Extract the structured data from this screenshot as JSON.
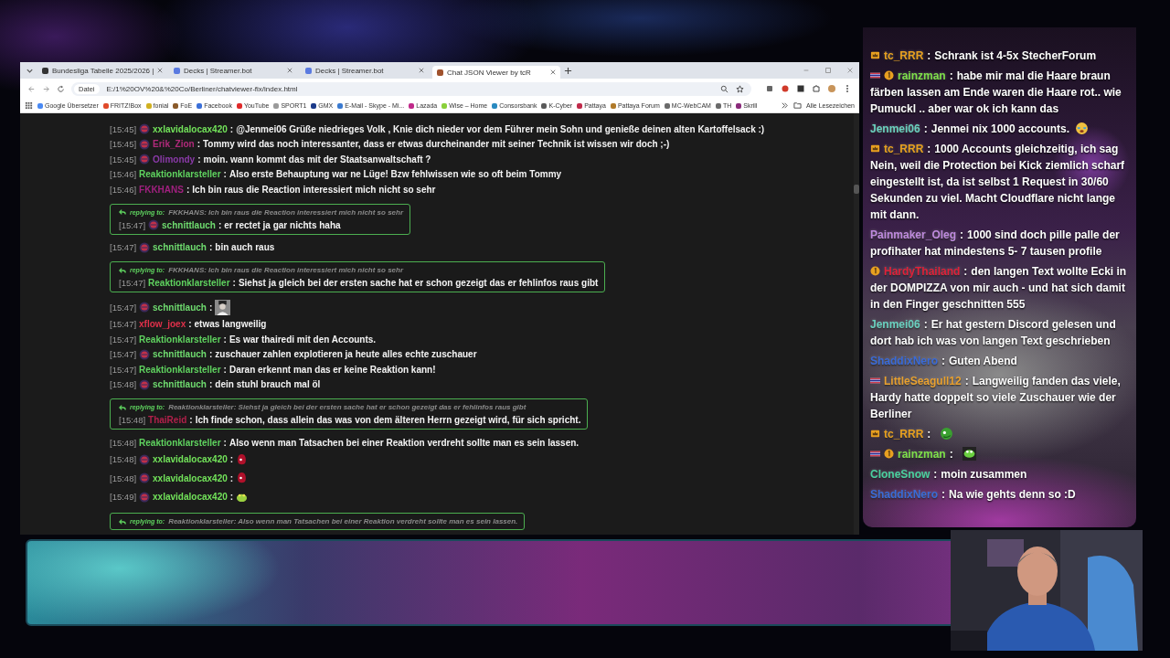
{
  "browser": {
    "tabs": [
      {
        "label": "Bundesliga Tabelle 2025/2026 |",
        "selected": false
      },
      {
        "label": "Decks | Streamer.bot",
        "selected": false
      },
      {
        "label": "Decks | Streamer.bot",
        "selected": false
      },
      {
        "label": "Chat JSON Viewer by tcR",
        "selected": true
      }
    ],
    "address": {
      "scheme": "Datei",
      "url": "E:/1%20OV%20&%20Co/Berliner/chatviewer-fix/index.html"
    },
    "bookmarks": [
      {
        "label": "Google Übersetzer",
        "color": "#4a8af4"
      },
      {
        "label": "FRITZ!Box",
        "color": "#e04a2a"
      },
      {
        "label": "fonial",
        "color": "#d0b020"
      },
      {
        "label": "FoE",
        "color": "#8a5a2a"
      },
      {
        "label": "Facebook",
        "color": "#3b6fd8"
      },
      {
        "label": "YouTube",
        "color": "#e02a2a"
      },
      {
        "label": "SPORT1",
        "color": "#9a9a9a"
      },
      {
        "label": "GMX",
        "color": "#1c3a8a"
      },
      {
        "label": "E-Mail - Skype - Mi...",
        "color": "#3a7ad0"
      },
      {
        "label": "Lazada",
        "color": "#c02a8a"
      },
      {
        "label": "Wise – Home",
        "color": "#8ad03a"
      },
      {
        "label": "Consorsbank",
        "color": "#2a8ac0"
      },
      {
        "label": "K-Cyber",
        "color": "#5a5a5a"
      },
      {
        "label": "Pattaya",
        "color": "#c02a4a"
      },
      {
        "label": "Pattaya Forum",
        "color": "#b07a2a"
      },
      {
        "label": "MC-WebCAM",
        "color": "#6a6a6a"
      },
      {
        "label": "TH",
        "color": "#6a6a6a"
      },
      {
        "label": "Skrill",
        "color": "#8a2a7a"
      }
    ],
    "all_bookmarks": "Alle Lesezeichen"
  },
  "chat": {
    "messages": [
      {
        "kind": "message",
        "time": "[15:45]",
        "user": "xxlavidalocax420",
        "color": "#72e35a",
        "badge": true,
        "sep": ":",
        "text": "@Jenmei06 Grüße niedrieges Volk , Knie dich nieder vor dem Führer mein Sohn und genieße deinen alten Kartoffelsack :)"
      },
      {
        "kind": "message",
        "time": "[15:45]",
        "user": "Erik_Zion",
        "color": "#b02a7a",
        "badge": true,
        "sep": ":",
        "text": "Tommy wird das noch interessanter, dass er etwas durcheinander mit seiner Technik ist wissen wir doch ;-)"
      },
      {
        "kind": "message",
        "time": "[15:45]",
        "user": "Olimondy",
        "color": "#8a3aa8",
        "badge": true,
        "sep": ":",
        "text": "moin. wann kommt das mit der Staatsanwaltschaft ?"
      },
      {
        "kind": "message",
        "time": "[15:46]",
        "user": "Reaktionklarsteller",
        "color": "#5fd35f",
        "badge": false,
        "sep": ":",
        "text": "Also erste Behauptung war ne Lüge! Bzw fehlwissen wie so oft beim Tommy"
      },
      {
        "kind": "message",
        "time": "[15:46]",
        "user": "FKKHANS",
        "color": "#a0207f",
        "badge": false,
        "sep": ":",
        "text": "Ich bin raus die Reaction interessiert mich nicht so sehr"
      },
      {
        "kind": "reply",
        "reply_label": "replying to:",
        "reply_to": "FKKHANS: Ich bin raus die Reaction interessiert mich nicht so sehr",
        "time": "[15:47]",
        "user": "schnittlauch",
        "color": "#6fdc6f",
        "badge": true,
        "sep": ":",
        "text": "er rectet ja gar nichts haha"
      },
      {
        "kind": "message",
        "time": "[15:47]",
        "user": "schnittlauch",
        "color": "#6fdc6f",
        "badge": true,
        "sep": ":",
        "text": "bin auch raus"
      },
      {
        "kind": "reply",
        "reply_label": "replying to:",
        "reply_to": "FKKHANS: Ich bin raus die Reaction interessiert mich nicht so sehr",
        "time": "[15:47]",
        "user": "Reaktionklarsteller",
        "color": "#5fd35f",
        "badge": false,
        "sep": ":",
        "text": "Siehst ja gleich bei der ersten sache hat er schon gezeigt das er fehlinfos raus gibt"
      },
      {
        "kind": "message",
        "time": "[15:47]",
        "user": "schnittlauch",
        "color": "#6fdc6f",
        "badge": true,
        "sep": ":",
        "emote": {
          "kind": "portrait"
        }
      },
      {
        "kind": "message",
        "time": "[15:47]",
        "user": "xflow_joex",
        "color": "#e0304a",
        "badge": false,
        "sep": ":",
        "text": "etwas langweilig"
      },
      {
        "kind": "message",
        "time": "[15:47]",
        "user": "Reaktionklarsteller",
        "color": "#5fd35f",
        "badge": false,
        "sep": ":",
        "text": "Es war thairedi mit den Accounts."
      },
      {
        "kind": "message",
        "time": "[15:47]",
        "user": "schnittlauch",
        "color": "#6fdc6f",
        "badge": true,
        "sep": ":",
        "text": "zuschauer zahlen explotieren ja heute alles echte zuschauer"
      },
      {
        "kind": "message",
        "time": "[15:47]",
        "user": "Reaktionklarsteller",
        "color": "#5fd35f",
        "badge": false,
        "sep": ":",
        "text": "Daran erkennt man das er keine Reaktion kann!"
      },
      {
        "kind": "message",
        "time": "[15:48]",
        "user": "schnittlauch",
        "color": "#6fdc6f",
        "badge": true,
        "sep": ":",
        "text": "dein stuhl brauch mal öl"
      },
      {
        "kind": "reply",
        "reply_label": "replying to:",
        "reply_to": "Reaktionklarsteller: Siehst ja gleich bei der ersten sache hat er schon gezeigt das er fehlinfos raus gibt",
        "time": "[15:48]",
        "user": "ThaiReid",
        "color": "#b0204a",
        "badge": false,
        "sep": ":",
        "text": "Ich finde schon, dass allein das was von dem älteren Herrn gezeigt wird, für sich spricht."
      },
      {
        "kind": "message",
        "time": "[15:48]",
        "user": "Reaktionklarsteller",
        "color": "#5fd35f",
        "badge": false,
        "sep": ":",
        "text": "Also wenn man Tatsachen bei einer Reaktion verdreht sollte man es sein lassen."
      },
      {
        "kind": "message",
        "time": "[15:48]",
        "user": "xxlavidalocax420",
        "color": "#72e35a",
        "badge": true,
        "sep": ":",
        "emote": {
          "kind": "blob"
        }
      },
      {
        "kind": "message",
        "time": "[15:48]",
        "user": "xxlavidalocax420",
        "color": "#72e35a",
        "badge": true,
        "sep": ":",
        "emote": {
          "kind": "blob"
        }
      },
      {
        "kind": "message",
        "time": "[15:49]",
        "user": "xxlavidalocax420",
        "color": "#72e35a",
        "badge": true,
        "sep": ":",
        "emote": {
          "kind": "frog"
        }
      },
      {
        "kind": "reply_only",
        "reply_label": "replying to:",
        "reply_to": "Reaktionklarsteller: Also wenn man Tatsachen bei einer Reaktion verdreht sollte man es sein lassen."
      }
    ]
  },
  "overlay_chat": {
    "messages": [
      {
        "user": "tc_RRR",
        "color": "#e8a020",
        "badges": [
          {
            "kind": "crown"
          }
        ],
        "sep": ":",
        "text": "Schrank ist 4-5x StecherForum"
      },
      {
        "user": "rainzman",
        "color": "#7ee04a",
        "badges": [
          {
            "kind": "flag"
          },
          {
            "kind": "coin"
          }
        ],
        "sep": ":",
        "text": "habe mir mal die Haare braun färben lassen am Ende waren die Haare rot.. wie Pumuckl .. aber war ok ich kann das"
      },
      {
        "user": "Jenmei06",
        "color": "#6ad0c0",
        "sep": ":",
        "text": "Jenmei nix 1000 accounts.",
        "emote": {
          "kind": "cry"
        }
      },
      {
        "user": "tc_RRR",
        "color": "#e8a020",
        "badges": [
          {
            "kind": "crown"
          }
        ],
        "sep": ":",
        "text": "1000 Accounts gleichzeitig, ich sag Nein, weil die Protection bei Kick ziemlich scharf eingestellt ist, da ist selbst 1 Request in 30/60 Sekunden zu viel. Macht Cloudflare nicht lange mit dann."
      },
      {
        "user": "Painmaker_Oleg",
        "color": "#c08ae0",
        "sep": ":",
        "text": "1000 sind doch pille palle der profihater hat mindestens 5- 7 tausen profile"
      },
      {
        "user": "HardyThailand",
        "color": "#e0203a",
        "badges": [
          {
            "kind": "coin"
          }
        ],
        "sep": ":",
        "text": "den langen Text wollte Ecki in der DOMPIZZA von mir auch - und hat sich damit in den Finger geschnitten 555"
      },
      {
        "user": "Jenmei06",
        "color": "#6ad0c0",
        "sep": ":",
        "text": "Er hat gestern Discord gelesen und dort hab ich was von langen Text geschrieben"
      },
      {
        "user": "ShaddixNero",
        "color": "#3a6ad8",
        "sep": ":",
        "text": "Guten Abend"
      },
      {
        "user": "LittleSeagull12",
        "color": "#e8a030",
        "badges": [
          {
            "kind": "flag"
          }
        ],
        "sep": ":",
        "text": "Langweilig fanden das viele, Hardy hatte doppelt so viele Zuschauer wie der Berliner"
      },
      {
        "user": "tc_RRR",
        "color": "#e8a020",
        "badges": [
          {
            "kind": "crown"
          }
        ],
        "sep": ":",
        "emote": {
          "kind": "pepe"
        }
      },
      {
        "user": "rainzman",
        "color": "#7ee04a",
        "badges": [
          {
            "kind": "flag"
          },
          {
            "kind": "coin"
          }
        ],
        "sep": ":",
        "emote": {
          "kind": "frog"
        }
      },
      {
        "user": "CloneSnow",
        "color": "#4ad0a0",
        "sep": ":",
        "text": "moin zusammen"
      },
      {
        "user": "ShaddixNero",
        "color": "#3a6ad8",
        "sep": ":",
        "text": "Na wie gehts denn so :D"
      }
    ]
  }
}
